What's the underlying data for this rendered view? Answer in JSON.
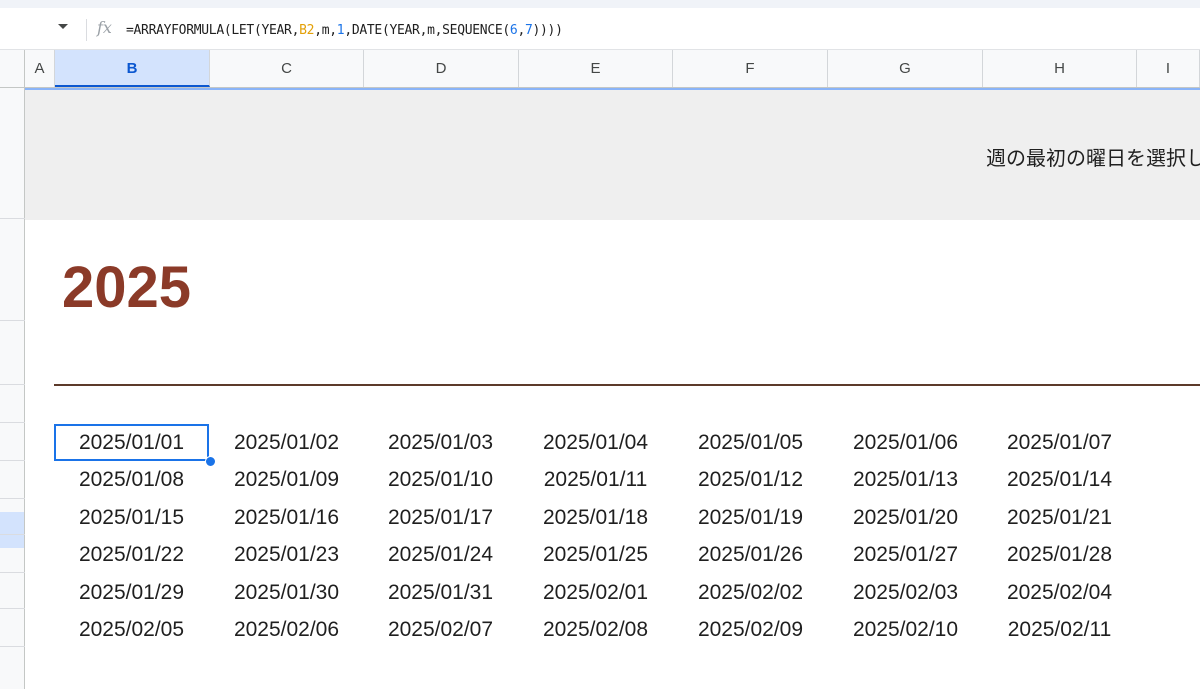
{
  "formula_bar": {
    "segments": [
      {
        "text": "=ARRAYFORMULA(LET(YEAR,",
        "kind": "plain"
      },
      {
        "text": "B2",
        "kind": "ref"
      },
      {
        "text": ",m,",
        "kind": "plain"
      },
      {
        "text": "1",
        "kind": "num"
      },
      {
        "text": ",DATE(YEAR,m,SEQUENCE(",
        "kind": "plain"
      },
      {
        "text": "6",
        "kind": "num"
      },
      {
        "text": ",",
        "kind": "plain"
      },
      {
        "text": "7",
        "kind": "num"
      },
      {
        "text": "))))",
        "kind": "plain"
      }
    ]
  },
  "columns": [
    "A",
    "B",
    "C",
    "D",
    "E",
    "F",
    "G",
    "H",
    "I"
  ],
  "selected_column": "B",
  "banner_text": "週の最初の曜日を選択し",
  "year": "2025",
  "dates": [
    [
      "2025/01/01",
      "2025/01/02",
      "2025/01/03",
      "2025/01/04",
      "2025/01/05",
      "2025/01/06",
      "2025/01/07"
    ],
    [
      "2025/01/08",
      "2025/01/09",
      "2025/01/10",
      "2025/01/11",
      "2025/01/12",
      "2025/01/13",
      "2025/01/14"
    ],
    [
      "2025/01/15",
      "2025/01/16",
      "2025/01/17",
      "2025/01/18",
      "2025/01/19",
      "2025/01/20",
      "2025/01/21"
    ],
    [
      "2025/01/22",
      "2025/01/23",
      "2025/01/24",
      "2025/01/25",
      "2025/01/26",
      "2025/01/27",
      "2025/01/28"
    ],
    [
      "2025/01/29",
      "2025/01/30",
      "2025/01/31",
      "2025/02/01",
      "2025/02/02",
      "2025/02/03",
      "2025/02/04"
    ],
    [
      "2025/02/05",
      "2025/02/06",
      "2025/02/07",
      "2025/02/08",
      "2025/02/09",
      "2025/02/10",
      "2025/02/11"
    ]
  ],
  "colors": {
    "year_text": "#8b3a28",
    "selection": "#1a73e8",
    "banner_bg": "#efefef"
  },
  "icons": {
    "namebox_dropdown": "chevron-down-icon",
    "formula": "fx-icon"
  }
}
